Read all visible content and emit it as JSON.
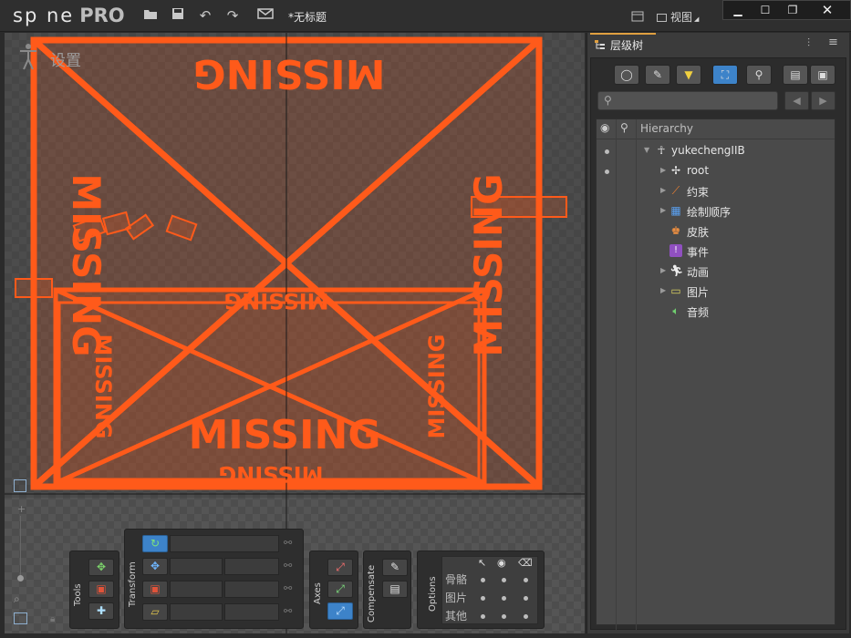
{
  "app": {
    "logo_text": "sp ne",
    "logo_suffix": "PRO",
    "document_title": "*无标题",
    "view_menu": "视图"
  },
  "viewport": {
    "mode_label": "设置",
    "missing_text": "MISSING"
  },
  "toolbar": {
    "tools_label": "Tools",
    "transform_label": "Transform",
    "axes_label": "Axes",
    "compensate_label": "Compensate",
    "options_label": "Options",
    "options_rows": [
      "骨骼",
      "图片",
      "其他"
    ]
  },
  "panel": {
    "tab_label": "层级树",
    "hierarchy_header": "Hierarchy",
    "tree": [
      {
        "label": "yukechengIIB",
        "icon": "skeleton-icon",
        "expandable": true,
        "level": 0
      },
      {
        "label": "root",
        "icon": "bone-icon",
        "expandable": true,
        "level": 1
      },
      {
        "label": "约束",
        "icon": "constraint-icon",
        "expandable": true,
        "level": 1
      },
      {
        "label": "绘制顺序",
        "icon": "draw-order-icon",
        "expandable": true,
        "level": 1
      },
      {
        "label": "皮肤",
        "icon": "skin-icon",
        "expandable": false,
        "level": 1
      },
      {
        "label": "事件",
        "icon": "event-icon",
        "expandable": false,
        "level": 1
      },
      {
        "label": "动画",
        "icon": "animation-icon",
        "expandable": true,
        "level": 1
      },
      {
        "label": "图片",
        "icon": "images-folder-icon",
        "expandable": true,
        "level": 1
      },
      {
        "label": "音频",
        "icon": "audio-icon",
        "expandable": false,
        "level": 1
      }
    ]
  },
  "colors": {
    "accent_blue": "#3d83c9",
    "missing_orange": "#ff5a1a",
    "tab_highlight": "#e0a040"
  }
}
